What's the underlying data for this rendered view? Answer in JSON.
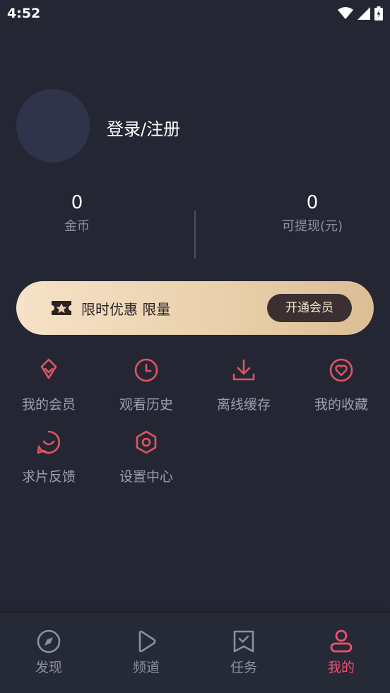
{
  "status_bar": {
    "time": "4:52"
  },
  "profile": {
    "login_label": "登录/注册"
  },
  "stats": [
    {
      "value": "0",
      "label": "金币"
    },
    {
      "value": "0",
      "label": "可提现(元)"
    }
  ],
  "vip_banner": {
    "text": "限时优惠 限量",
    "button_label": "开通会员"
  },
  "menu": {
    "items": [
      {
        "label": "我的会员",
        "icon": "diamond-icon"
      },
      {
        "label": "观看历史",
        "icon": "clock-icon"
      },
      {
        "label": "离线缓存",
        "icon": "download-icon"
      },
      {
        "label": "我的收藏",
        "icon": "heart-icon"
      },
      {
        "label": "求片反馈",
        "icon": "chat-smile-icon"
      },
      {
        "label": "设置中心",
        "icon": "settings-icon"
      }
    ]
  },
  "bottom_nav": {
    "items": [
      {
        "label": "发现",
        "icon": "compass-icon"
      },
      {
        "label": "频道",
        "icon": "play-icon"
      },
      {
        "label": "任务",
        "icon": "task-icon"
      },
      {
        "label": "我的",
        "icon": "user-icon",
        "active": true
      }
    ]
  },
  "colors": {
    "background": "#242733",
    "accent": "#e15462",
    "nav_active": "#f0506e",
    "vip_gold": "#ead1ad"
  }
}
